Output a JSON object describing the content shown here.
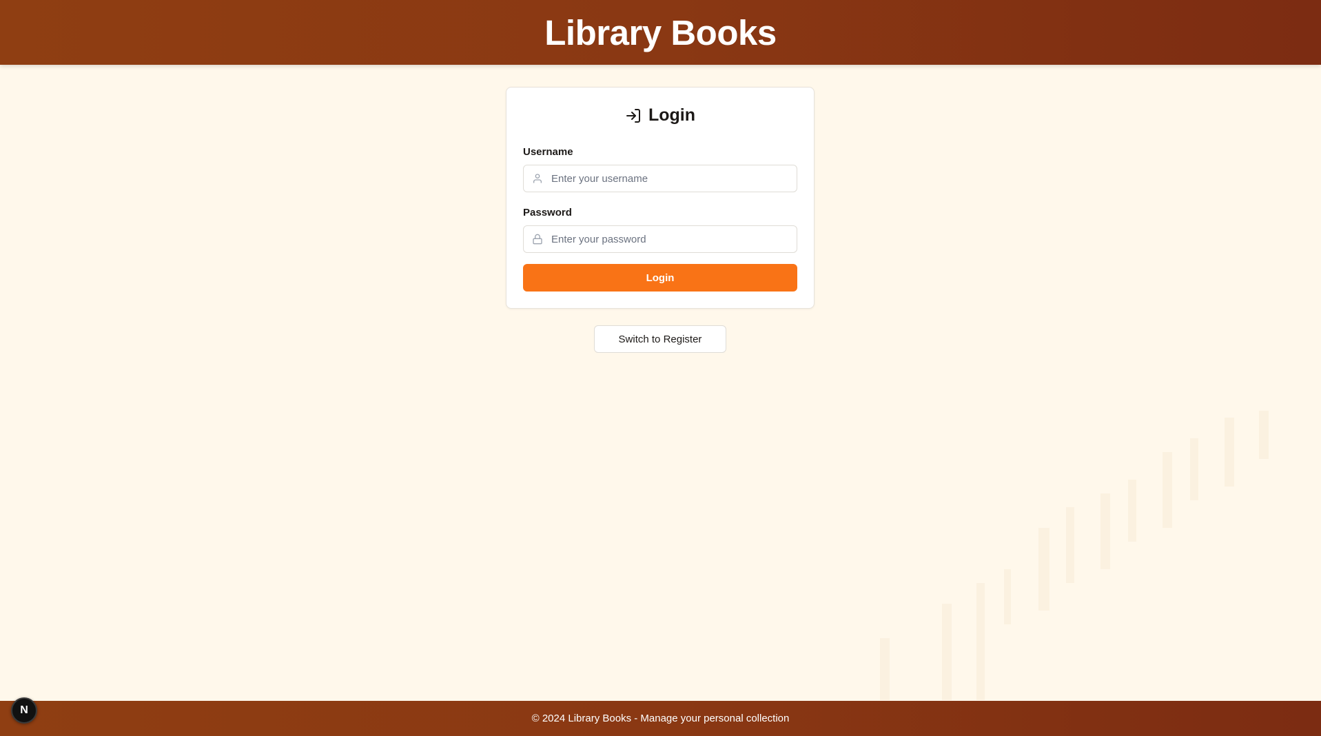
{
  "header": {
    "title": "Library Books"
  },
  "login_card": {
    "title": "Login",
    "title_icon": "log-in-icon",
    "username": {
      "label": "Username",
      "placeholder": "Enter your username",
      "icon": "user-icon",
      "value": ""
    },
    "password": {
      "label": "Password",
      "placeholder": "Enter your password",
      "icon": "lock-icon",
      "value": ""
    },
    "submit_label": "Login"
  },
  "switch_button": {
    "label": "Switch to Register"
  },
  "footer": {
    "text": "© 2024 Library Books - Manage your personal collection"
  },
  "dev_badge": {
    "letter": "N"
  },
  "colors": {
    "header_bg": "#8a3813",
    "page_bg": "#fff8eb",
    "accent": "#f97316",
    "card_bg": "#ffffff"
  }
}
